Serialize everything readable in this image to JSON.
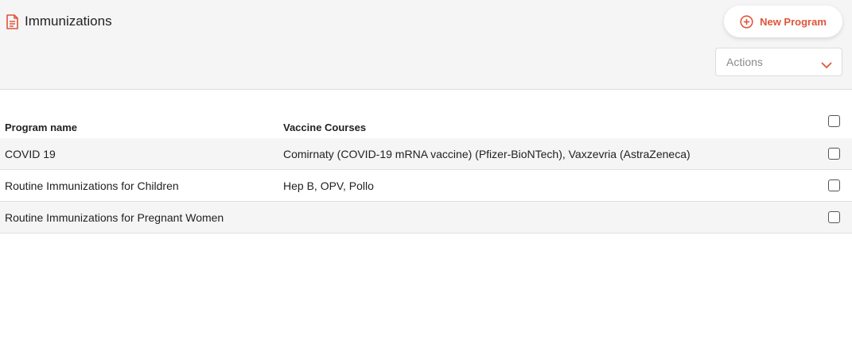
{
  "header": {
    "title": "Immunizations",
    "new_program_label": "New Program",
    "actions_placeholder": "Actions",
    "accent_color": "#e0553a"
  },
  "table": {
    "columns": [
      "Program name",
      "Vaccine Courses"
    ],
    "rows": [
      {
        "program": "COVID 19",
        "courses": "Comirnaty (COVID-19 mRNA vaccine) (Pfizer-BioNTech), Vaxzevria (AstraZeneca)",
        "checked": false
      },
      {
        "program": "Routine Immunizations for Children",
        "courses": "Hep B, OPV, Pollo",
        "checked": false
      },
      {
        "program": "Routine Immunizations for Pregnant Women",
        "courses": "",
        "checked": false
      }
    ]
  }
}
